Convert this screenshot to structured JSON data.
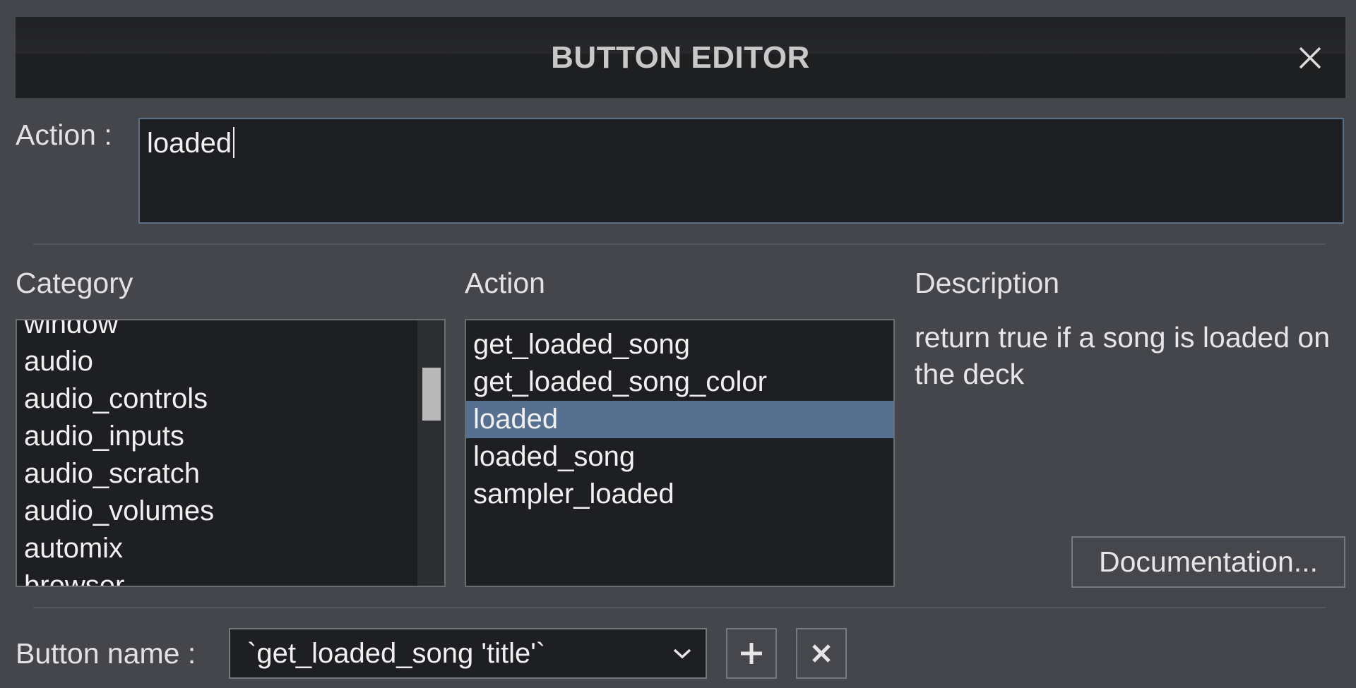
{
  "window": {
    "title": "BUTTON EDITOR",
    "close_icon": "close-icon"
  },
  "action_field": {
    "label": "Action :",
    "value": "loaded"
  },
  "columns": {
    "category_header": "Category",
    "action_header": "Action",
    "description_header": "Description"
  },
  "category_list": {
    "items": [
      "window",
      "audio",
      "audio_controls",
      "audio_inputs",
      "audio_scratch",
      "audio_volumes",
      "automix",
      "browser"
    ]
  },
  "action_list": {
    "items": [
      "get_loaded_song",
      "get_loaded_song_color",
      "loaded",
      "loaded_song",
      "sampler_loaded"
    ],
    "selected": "loaded"
  },
  "description": {
    "text": "return true if a song is loaded on the deck"
  },
  "documentation_button": {
    "label": "Documentation..."
  },
  "button_name": {
    "label": "Button name :",
    "value": "`get_loaded_song 'title'`",
    "dropdown_icon": "chevron-down-icon"
  },
  "toolbar": {
    "add_icon": "plus-icon",
    "remove_icon": "x-icon"
  },
  "colors": {
    "background": "#44464b",
    "field_background": "#1e1f22",
    "selection": "#57708f",
    "input_border": "#5c6f86"
  }
}
